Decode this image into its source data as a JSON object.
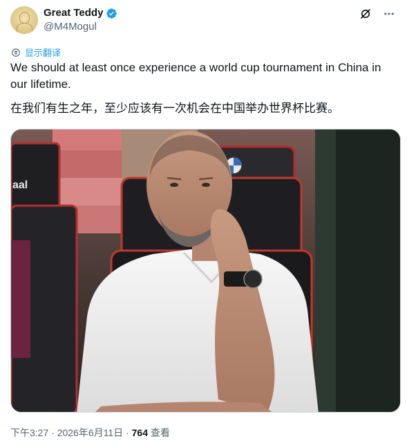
{
  "author": {
    "display_name": "Great Teddy",
    "handle": "@M4Mogul"
  },
  "icons": {
    "verified": "verified-badge-icon",
    "grok": "grok-icon",
    "more": "more-icon",
    "translate": "translate-icon"
  },
  "translate_label": "显示翻译",
  "tweet": {
    "text_en": "We should at least once experience a world cup tournament in China in our lifetime.",
    "text_zh": "在我们有生之年，至少应该有一次机会在中国举办世界杯比赛。"
  },
  "photo": {
    "seat_text": "aal"
  },
  "footer": {
    "time": "下午3:27",
    "sep1": " · ",
    "date": "2026年6月11日",
    "sep2": " · ",
    "views": "764",
    "views_label": " 查看"
  },
  "colors": {
    "accent": "#1d9bf0",
    "secondary_text": "#536471"
  }
}
